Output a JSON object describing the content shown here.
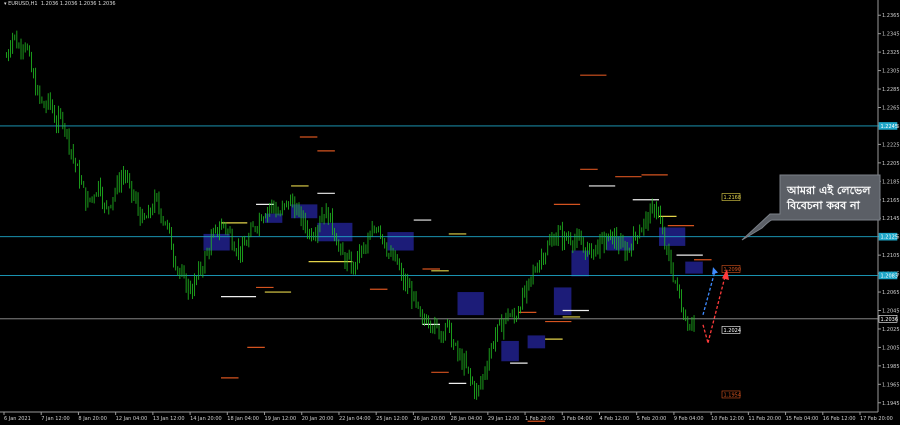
{
  "chart_header": {
    "symbol_timeframe": "EURUSD,H1",
    "ohlc": "1.2036 1.2036 1.2036 1.2036"
  },
  "callout": {
    "line1": "আমরা এই লেভেল",
    "line2": "বিবেচনা করব না"
  },
  "colors": {
    "background": "#000000",
    "candles": "#22c122",
    "axis": "#9a9a9a",
    "hline": "#1ea7c9",
    "zone": "#1c1c78",
    "callout_bg": "#5b5f66",
    "yellow_level": "#e3d34a",
    "orange_level": "#d4531f",
    "white_level": "#eeeeee",
    "arrow_blue": "#3e8bff",
    "arrow_red": "#ff3b3b"
  },
  "chart_data": {
    "type": "candlestick",
    "symbol": "EURUSD",
    "timeframe": "H1",
    "ylim": [
      1.1935,
      1.2375
    ],
    "y_ticks": [
      "1.2365",
      "1.2345",
      "1.2325",
      "1.2305",
      "1.2285",
      "1.2265",
      "1.2245",
      "1.2225",
      "1.2205",
      "1.2185",
      "1.2165",
      "1.2145",
      "1.2125",
      "1.2105",
      "1.2085",
      "1.2065",
      "1.2045",
      "1.2025",
      "1.2005",
      "1.1985",
      "1.1965",
      "1.1945"
    ],
    "x_ticks": [
      "6 Jan 2021",
      "7 Jan 12:00",
      "8 Jan 20:00",
      "12 Jan 04:00",
      "13 Jan 12:00",
      "14 Jan 20:00",
      "18 Jan 04:00",
      "19 Jan 12:00",
      "20 Jan 20:00",
      "22 Jan 04:00",
      "25 Jan 12:00",
      "26 Jan 20:00",
      "28 Jan 04:00",
      "29 Jan 12:00",
      "1 Feb 20:00",
      "3 Feb 04:00",
      "4 Feb 12:00",
      "5 Feb 20:00",
      "9 Feb 04:00",
      "10 Feb 12:00",
      "11 Feb 20:00",
      "15 Feb 04:00",
      "16 Feb 12:00",
      "17 Feb 20:00"
    ],
    "close_path": [
      1.232,
      1.2345,
      1.233,
      1.2338,
      1.2305,
      1.228,
      1.2265,
      1.2272,
      1.2248,
      1.2255,
      1.223,
      1.2205,
      1.2185,
      1.216,
      1.217,
      1.2185,
      1.215,
      1.2168,
      1.2182,
      1.2195,
      1.2175,
      1.216,
      1.214,
      1.2148,
      1.2165,
      1.215,
      1.2135,
      1.2105,
      1.2085,
      1.2072,
      1.2068,
      1.2085,
      1.21,
      1.212,
      1.2132,
      1.214,
      1.2128,
      1.2115,
      1.2108,
      1.2122,
      1.2135,
      1.2148,
      1.2155,
      1.216,
      1.2148,
      1.2158,
      1.2165,
      1.215,
      1.214,
      1.2128,
      1.2135,
      1.2152,
      1.2148,
      1.213,
      1.2105,
      1.2098,
      1.209,
      1.2108,
      1.2112,
      1.2128,
      1.214,
      1.212,
      1.2102,
      1.2098,
      1.2075,
      1.207,
      1.2052,
      1.203,
      1.204,
      1.2028,
      1.202,
      1.2032,
      1.201,
      1.1995,
      1.1985,
      1.1968,
      1.1955,
      1.1975,
      1.2,
      1.202,
      1.203,
      1.2042,
      1.2035,
      1.2055,
      1.2065,
      1.2085,
      1.21,
      1.211,
      1.212,
      1.213,
      1.2122,
      1.2125,
      1.212,
      1.2115,
      1.2108,
      1.2112,
      1.2118,
      1.2122,
      1.2125,
      1.2115,
      1.2108,
      1.212,
      1.2132,
      1.214,
      1.215,
      1.216,
      1.2122,
      1.2098,
      1.2075,
      1.205,
      1.203,
      1.2038
    ],
    "levels": [
      {
        "price": 1.2245,
        "kind": "hline"
      },
      {
        "price": 1.2125,
        "kind": "hline"
      },
      {
        "price": 1.2083,
        "kind": "hline"
      },
      {
        "price": 1.2036,
        "kind": "current"
      }
    ],
    "level_labels": [
      {
        "text": "1.2245",
        "style": "blue"
      },
      {
        "text": "1.2125",
        "style": "blue"
      },
      {
        "text": "1.2083",
        "style": "blue"
      },
      {
        "text": "1.2036",
        "style": "white"
      },
      {
        "text": "1.2168",
        "style": "yellow"
      },
      {
        "text": "1.2090",
        "style": "red"
      },
      {
        "text": "1.2024",
        "style": "white"
      },
      {
        "text": "1.1954",
        "style": "red"
      }
    ],
    "short_segments": [
      {
        "x0": 0.34,
        "x1": 0.36,
        "p": 1.2233,
        "c": "orange"
      },
      {
        "x0": 0.36,
        "x1": 0.38,
        "p": 1.2218,
        "c": "orange"
      },
      {
        "x0": 0.33,
        "x1": 0.35,
        "p": 1.218,
        "c": "yellow"
      },
      {
        "x0": 0.36,
        "x1": 0.38,
        "p": 1.2172,
        "c": "white"
      },
      {
        "x0": 0.25,
        "x1": 0.28,
        "p": 1.214,
        "c": "yellow"
      },
      {
        "x0": 0.29,
        "x1": 0.31,
        "p": 1.216,
        "c": "white"
      },
      {
        "x0": 0.47,
        "x1": 0.49,
        "p": 1.2143,
        "c": "white"
      },
      {
        "x0": 0.51,
        "x1": 0.53,
        "p": 1.2128,
        "c": "yellow"
      },
      {
        "x0": 0.49,
        "x1": 0.51,
        "p": 1.2088,
        "c": "yellow"
      },
      {
        "x0": 0.48,
        "x1": 0.5,
        "p": 1.209,
        "c": "orange"
      },
      {
        "x0": 0.27,
        "x1": 0.29,
        "p": 1.206,
        "c": "white"
      },
      {
        "x0": 0.3,
        "x1": 0.33,
        "p": 1.2065,
        "c": "yellow"
      },
      {
        "x0": 0.42,
        "x1": 0.44,
        "p": 1.2068,
        "c": "orange"
      },
      {
        "x0": 0.29,
        "x1": 0.31,
        "p": 1.207,
        "c": "orange"
      },
      {
        "x0": 0.25,
        "x1": 0.27,
        "p": 1.206,
        "c": "white"
      },
      {
        "x0": 0.35,
        "x1": 0.4,
        "p": 1.2098,
        "c": "yellow"
      },
      {
        "x0": 0.28,
        "x1": 0.3,
        "p": 1.2005,
        "c": "orange"
      },
      {
        "x0": 0.25,
        "x1": 0.27,
        "p": 1.1972,
        "c": "orange"
      },
      {
        "x0": 0.48,
        "x1": 0.5,
        "p": 1.203,
        "c": "white"
      },
      {
        "x0": 0.49,
        "x1": 0.51,
        "p": 1.1978,
        "c": "orange"
      },
      {
        "x0": 0.51,
        "x1": 0.53,
        "p": 1.1966,
        "c": "white"
      },
      {
        "x0": 0.59,
        "x1": 0.61,
        "p": 1.2043,
        "c": "orange"
      },
      {
        "x0": 0.58,
        "x1": 0.6,
        "p": 1.1988,
        "c": "white"
      },
      {
        "x0": 0.6,
        "x1": 0.62,
        "p": 1.1925,
        "c": "orange"
      },
      {
        "x0": 0.62,
        "x1": 0.65,
        "p": 1.2033,
        "c": "orange"
      },
      {
        "x0": 0.62,
        "x1": 0.64,
        "p": 1.2014,
        "c": "yellow"
      },
      {
        "x0": 0.64,
        "x1": 0.67,
        "p": 1.2045,
        "c": "white"
      },
      {
        "x0": 0.64,
        "x1": 0.66,
        "p": 1.2038,
        "c": "yellow"
      },
      {
        "x0": 0.66,
        "x1": 0.68,
        "p": 1.2198,
        "c": "orange"
      },
      {
        "x0": 0.67,
        "x1": 0.7,
        "p": 1.218,
        "c": "white"
      },
      {
        "x0": 0.63,
        "x1": 0.66,
        "p": 1.216,
        "c": "orange"
      },
      {
        "x0": 0.66,
        "x1": 0.69,
        "p": 1.23,
        "c": "orange"
      },
      {
        "x0": 0.7,
        "x1": 0.73,
        "p": 1.219,
        "c": "orange"
      },
      {
        "x0": 0.73,
        "x1": 0.76,
        "p": 1.2192,
        "c": "orange"
      },
      {
        "x0": 0.75,
        "x1": 0.77,
        "p": 1.2147,
        "c": "yellow"
      },
      {
        "x0": 0.72,
        "x1": 0.75,
        "p": 1.2165,
        "c": "white"
      },
      {
        "x0": 0.76,
        "x1": 0.79,
        "p": 1.2137,
        "c": "orange"
      },
      {
        "x0": 0.77,
        "x1": 0.8,
        "p": 1.2105,
        "c": "white"
      },
      {
        "x0": 0.79,
        "x1": 0.81,
        "p": 1.21,
        "c": "orange"
      }
    ],
    "zones": [
      {
        "x0": 0.23,
        "x1": 0.26,
        "p_hi": 1.2128,
        "p_lo": 1.211
      },
      {
        "x0": 0.3,
        "x1": 0.32,
        "p_hi": 1.215,
        "p_lo": 1.214
      },
      {
        "x0": 0.33,
        "x1": 0.36,
        "p_hi": 1.216,
        "p_lo": 1.2145
      },
      {
        "x0": 0.36,
        "x1": 0.4,
        "p_hi": 1.214,
        "p_lo": 1.212
      },
      {
        "x0": 0.44,
        "x1": 0.47,
        "p_hi": 1.213,
        "p_lo": 1.211
      },
      {
        "x0": 0.52,
        "x1": 0.55,
        "p_hi": 1.2065,
        "p_lo": 1.204
      },
      {
        "x0": 0.57,
        "x1": 0.59,
        "p_hi": 1.2012,
        "p_lo": 1.199
      },
      {
        "x0": 0.6,
        "x1": 0.62,
        "p_hi": 1.2018,
        "p_lo": 1.2004
      },
      {
        "x0": 0.63,
        "x1": 0.65,
        "p_hi": 1.207,
        "p_lo": 1.204
      },
      {
        "x0": 0.65,
        "x1": 0.67,
        "p_hi": 1.211,
        "p_lo": 1.2082
      },
      {
        "x0": 0.69,
        "x1": 0.72,
        "p_hi": 1.2125,
        "p_lo": 1.211
      },
      {
        "x0": 0.75,
        "x1": 0.78,
        "p_hi": 1.2135,
        "p_lo": 1.2115
      },
      {
        "x0": 0.78,
        "x1": 0.8,
        "p_hi": 1.2098,
        "p_lo": 1.2085
      }
    ]
  }
}
